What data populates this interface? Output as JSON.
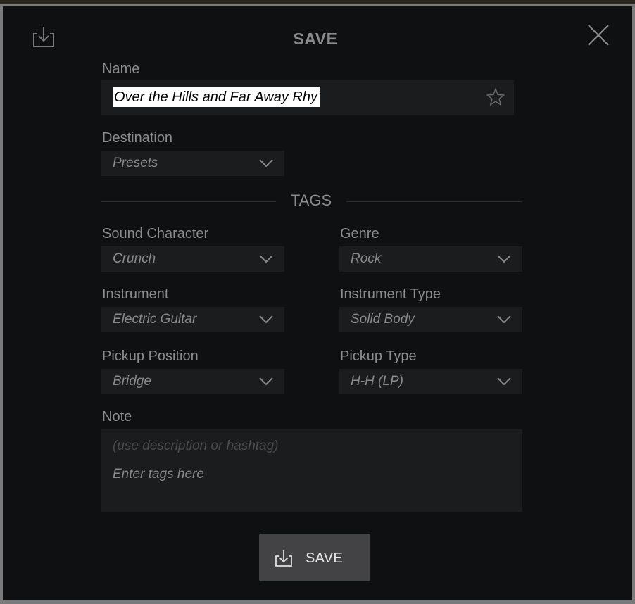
{
  "dialog": {
    "title": "SAVE",
    "header_icon": "save-download-icon",
    "close_icon": "close-icon"
  },
  "name": {
    "label": "Name",
    "value": "Over the Hills and Far Away Rhy",
    "favorite_icon": "star-outline-icon"
  },
  "destination": {
    "label": "Destination",
    "value": "Presets"
  },
  "tags": {
    "heading": "TAGS",
    "sound_character": {
      "label": "Sound Character",
      "value": "Crunch"
    },
    "genre": {
      "label": "Genre",
      "value": "Rock"
    },
    "instrument": {
      "label": "Instrument",
      "value": "Electric Guitar"
    },
    "instrument_type": {
      "label": "Instrument Type",
      "value": "Solid Body"
    },
    "pickup_position": {
      "label": "Pickup Position",
      "value": "Bridge"
    },
    "pickup_type": {
      "label": "Pickup Type",
      "value": "H-H (LP)"
    }
  },
  "note": {
    "label": "Note",
    "hint": "(use description or hashtag)",
    "placeholder": "Enter tags here"
  },
  "save_button": {
    "label": "SAVE",
    "icon": "save-download-icon"
  },
  "colors": {
    "background": "#0f1012",
    "field": "#1b1c1e",
    "border": "#7a7a7a",
    "button": "#434345",
    "label_text": "#8c8c8c"
  }
}
